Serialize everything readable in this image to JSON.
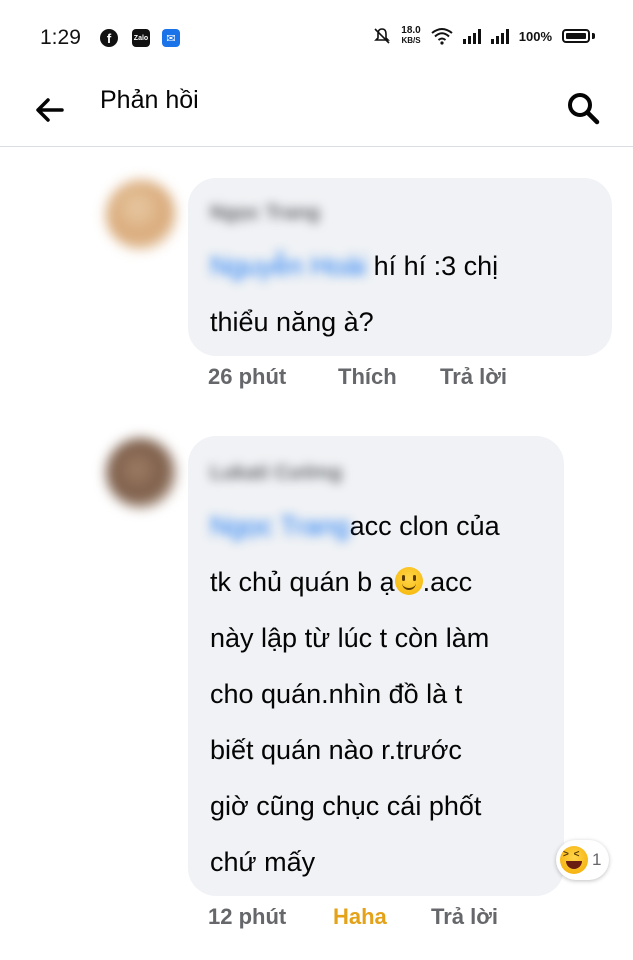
{
  "status_bar": {
    "time": "1:29",
    "speed_value": "18.0",
    "speed_unit": "KB/S",
    "battery": "100%"
  },
  "header": {
    "title": "Phản hồi"
  },
  "comments": [
    {
      "author": "Ngọc Trang",
      "mention": "Nguyễn Hoài",
      "lines": [
        "hí hí :3 chị",
        "thiểu năng à?"
      ],
      "time": "26 phút",
      "like_label": "Thích",
      "reply_label": "Trả lời"
    },
    {
      "author": "Lukati Cường",
      "mention": "Ngọc Trang",
      "lines": [
        "acc clon của",
        "tk chủ quán b ạ",
        ".acc",
        "này lập từ lúc t còn làm",
        "cho quán.nhìn đồ là t",
        "biết quán nào r.trước",
        "giờ cũng chục cái phốt",
        "chứ mấy"
      ],
      "time": "12 phút",
      "like_label": "Haha",
      "reply_label": "Trả lời",
      "reaction_count": "1"
    }
  ],
  "colors": {
    "bubble": "#f0f2f5",
    "mention": "#1877f2",
    "meta": "#65676b",
    "haha": "#e4a219"
  }
}
